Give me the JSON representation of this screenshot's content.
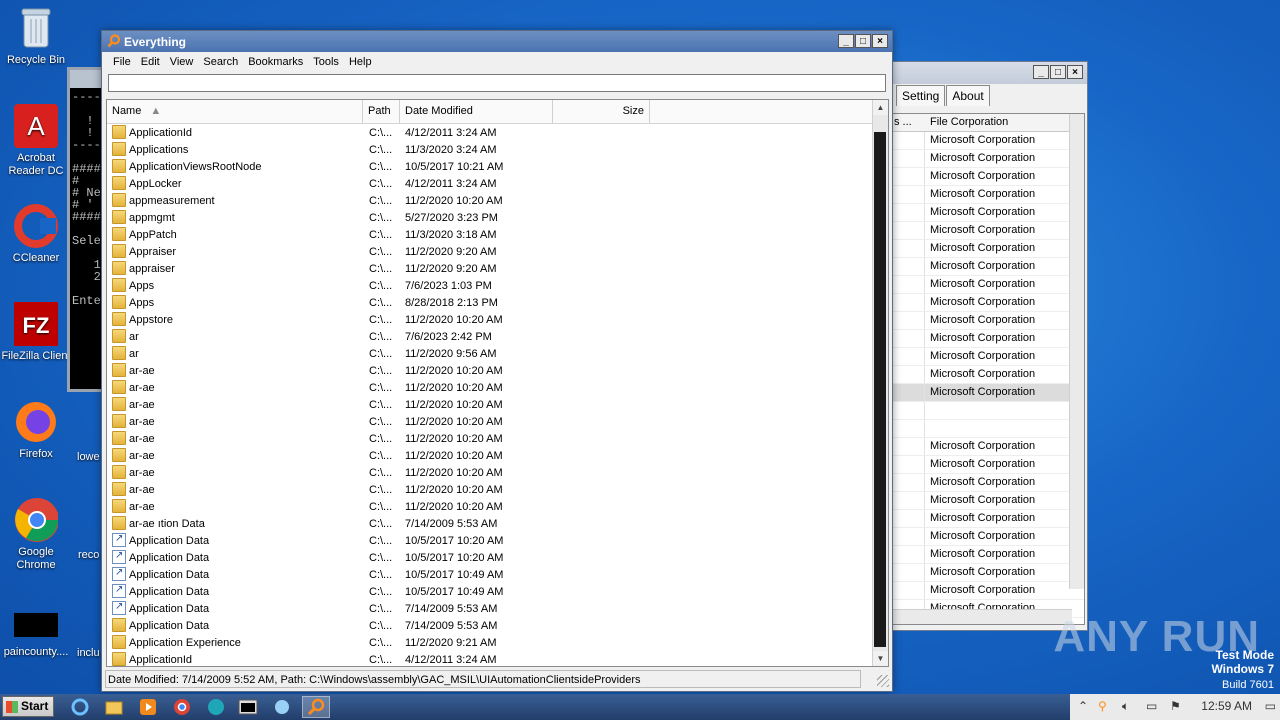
{
  "desktop": {
    "icons": [
      {
        "label": "Recycle Bin"
      },
      {
        "label": "Acrobat Reader DC"
      },
      {
        "label": "CCleaner"
      },
      {
        "label": "FileZilla Client"
      },
      {
        "label": "Firefox"
      },
      {
        "label": "Google Chrome"
      },
      {
        "label": "paincounty...."
      }
    ],
    "partial_labels": [
      "lowe",
      "reco",
      "inclu"
    ]
  },
  "console": {
    "lines": [
      "----",
      "",
      "  !",
      "  !",
      "----",
      "",
      "####",
      "#",
      "# Ne",
      "# '",
      "####",
      "",
      "Sele",
      "",
      "   1",
      "   2",
      "",
      "Ente"
    ]
  },
  "window2": {
    "tabs": [
      "Setting",
      "About"
    ],
    "columns": [
      "s ...",
      "File Corporation"
    ],
    "rows": [
      "Microsoft Corporation",
      "Microsoft Corporation",
      "Microsoft Corporation",
      "Microsoft Corporation",
      "Microsoft Corporation",
      "Microsoft Corporation",
      "Microsoft Corporation",
      "Microsoft Corporation",
      "Microsoft Corporation",
      "Microsoft Corporation",
      "Microsoft Corporation",
      "Microsoft Corporation",
      "Microsoft Corporation",
      "Microsoft Corporation",
      "Microsoft Corporation",
      "",
      "",
      "Microsoft Corporation",
      "Microsoft Corporation",
      "Microsoft Corporation",
      "Microsoft Corporation",
      "Microsoft Corporation",
      "Microsoft Corporation",
      "Microsoft Corporation",
      "Microsoft Corporation",
      "Microsoft Corporation",
      "Microsoft Corporation"
    ],
    "selected_row": 14
  },
  "everything": {
    "title": "Everything",
    "menu": [
      "File",
      "Edit",
      "View",
      "Search",
      "Bookmarks",
      "Tools",
      "Help"
    ],
    "search_value": "",
    "columns": {
      "name": "Name",
      "path": "Path",
      "date": "Date Modified",
      "size": "Size"
    },
    "rows": [
      {
        "name": "ApplicationId",
        "path": "C:\\...",
        "date": "4/12/2011 3:24 AM",
        "icon": "folder"
      },
      {
        "name": "Applications",
        "path": "C:\\...",
        "date": "11/3/2020 3:24 AM",
        "icon": "folder"
      },
      {
        "name": "ApplicationViewsRootNode",
        "path": "C:\\...",
        "date": "10/5/2017 10:21 AM",
        "icon": "folder"
      },
      {
        "name": "AppLocker",
        "path": "C:\\...",
        "date": "4/12/2011 3:24 AM",
        "icon": "folder"
      },
      {
        "name": "appmeasurement",
        "path": "C:\\...",
        "date": "11/2/2020 10:20 AM",
        "icon": "folder"
      },
      {
        "name": "appmgmt",
        "path": "C:\\...",
        "date": "5/27/2020 3:23 PM",
        "icon": "folder"
      },
      {
        "name": "AppPatch",
        "path": "C:\\...",
        "date": "11/3/2020 3:18 AM",
        "icon": "folder"
      },
      {
        "name": "Appraiser",
        "path": "C:\\...",
        "date": "11/2/2020 9:20 AM",
        "icon": "folder"
      },
      {
        "name": "appraiser",
        "path": "C:\\...",
        "date": "11/2/2020 9:20 AM",
        "icon": "folder"
      },
      {
        "name": "Apps",
        "path": "C:\\...",
        "date": "7/6/2023 1:03 PM",
        "icon": "folder"
      },
      {
        "name": "Apps",
        "path": "C:\\...",
        "date": "8/28/2018 2:13 PM",
        "icon": "folder"
      },
      {
        "name": "Appstore",
        "path": "C:\\...",
        "date": "11/2/2020 10:20 AM",
        "icon": "folder"
      },
      {
        "name": "ar",
        "path": "C:\\...",
        "date": "7/6/2023 2:42 PM",
        "icon": "folder"
      },
      {
        "name": "ar",
        "path": "C:\\...",
        "date": "11/2/2020 9:56 AM",
        "icon": "folder"
      },
      {
        "name": "ar-ae",
        "path": "C:\\...",
        "date": "11/2/2020 10:20 AM",
        "icon": "folder"
      },
      {
        "name": "ar-ae",
        "path": "C:\\...",
        "date": "11/2/2020 10:20 AM",
        "icon": "folder"
      },
      {
        "name": "ar-ae",
        "path": "C:\\...",
        "date": "11/2/2020 10:20 AM",
        "icon": "folder"
      },
      {
        "name": "ar-ae",
        "path": "C:\\...",
        "date": "11/2/2020 10:20 AM",
        "icon": "folder"
      },
      {
        "name": "ar-ae",
        "path": "C:\\...",
        "date": "11/2/2020 10:20 AM",
        "icon": "folder"
      },
      {
        "name": "ar-ae",
        "path": "C:\\...",
        "date": "11/2/2020 10:20 AM",
        "icon": "folder"
      },
      {
        "name": "ar-ae",
        "path": "C:\\...",
        "date": "11/2/2020 10:20 AM",
        "icon": "folder"
      },
      {
        "name": "ar-ae",
        "path": "C:\\...",
        "date": "11/2/2020 10:20 AM",
        "icon": "folder"
      },
      {
        "name": "ar-ae",
        "path": "C:\\...",
        "date": "11/2/2020 10:20 AM",
        "icon": "folder"
      },
      {
        "name": "ar-ae ıtion Data",
        "path": "C:\\...",
        "date": "7/14/2009 5:53 AM",
        "icon": "folder"
      },
      {
        "name": "Application Data",
        "path": "C:\\...",
        "date": "10/5/2017 10:20 AM",
        "icon": "shortcut"
      },
      {
        "name": "Application Data",
        "path": "C:\\...",
        "date": "10/5/2017 10:20 AM",
        "icon": "shortcut"
      },
      {
        "name": "Application Data",
        "path": "C:\\...",
        "date": "10/5/2017 10:49 AM",
        "icon": "shortcut"
      },
      {
        "name": "Application Data",
        "path": "C:\\...",
        "date": "10/5/2017 10:49 AM",
        "icon": "shortcut"
      },
      {
        "name": "Application Data",
        "path": "C:\\...",
        "date": "7/14/2009 5:53 AM",
        "icon": "shortcut"
      },
      {
        "name": "Application Data",
        "path": "C:\\...",
        "date": "7/14/2009 5:53 AM",
        "icon": "folder"
      },
      {
        "name": "Application Experience",
        "path": "C:\\...",
        "date": "11/2/2020 9:21 AM",
        "icon": "folder"
      },
      {
        "name": "ApplicationId",
        "path": "C:\\...",
        "date": "4/12/2011 3:24 AM",
        "icon": "folder"
      }
    ],
    "status": "Date Modified: 7/14/2009 5:52 AM, Path: C:\\Windows\\assembly\\GAC_MSIL\\UIAutomationClientsideProviders"
  },
  "taskbar": {
    "start_label": "Start",
    "clock": "12:59 AM"
  },
  "watermark": {
    "text": "ANY RUN"
  },
  "testmode": {
    "line1": "Test Mode",
    "line2": "Windows 7",
    "line3": "Build 7601"
  },
  "colors": {
    "desktop": "#1766c7",
    "titlebar": "#4c73b1",
    "taskbar": "#223e6b"
  }
}
